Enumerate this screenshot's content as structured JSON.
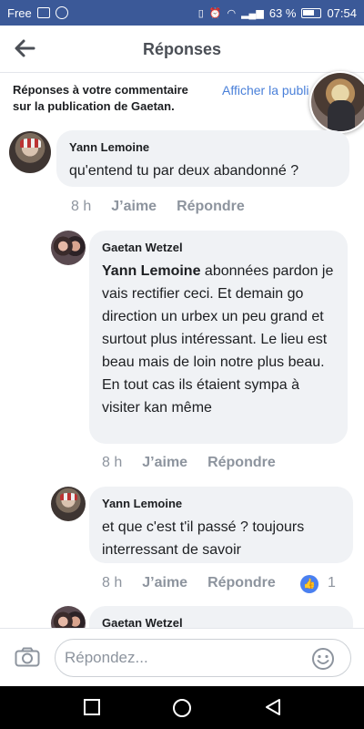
{
  "status_bar": {
    "carrier": "Free",
    "battery": "63 %",
    "time": "07:54"
  },
  "header": {
    "title": "Réponses"
  },
  "context": {
    "line1": "Réponses à votre commentaire",
    "line2": "sur la publication de Gaetan.",
    "view_link": "Afficher la publi"
  },
  "comments": [
    {
      "author": "Yann Lemoine",
      "text": "qu'entend tu par deux abandonné ?",
      "time": "8 h",
      "like": "J’aime",
      "reply": "Répondre"
    },
    {
      "author": "Gaetan Wetzel",
      "mention": "Yann Lemoine",
      "text": "abonnées pardon je vais rectifier ceci. Et demain go direction un urbex un peu grand et surtout plus intéressant. Le lieu est beau mais de loin notre plus beau. En tout cas ils étaient sympa à visiter kan même",
      "time": "8 h",
      "like": "J’aime",
      "reply": "Répondre"
    },
    {
      "author": "Yann Lemoine",
      "text": "et que c'est t'il passé ? toujours interressant de savoir",
      "time": "8 h",
      "like": "J’aime",
      "reply": "Répondre",
      "reaction_count": "1"
    },
    {
      "author": "Gaetan Wetzel"
    }
  ],
  "composer": {
    "placeholder": "Répondez..."
  },
  "icons": {
    "back": "arrow-left-icon",
    "camera": "camera-icon",
    "emoji": "smiley-icon",
    "reaction": "like-reaction-icon"
  },
  "colors": {
    "status_bar": "#3b5998",
    "link": "#4a80d9",
    "bubble": "#f0f2f5",
    "meta": "#8d949e"
  }
}
